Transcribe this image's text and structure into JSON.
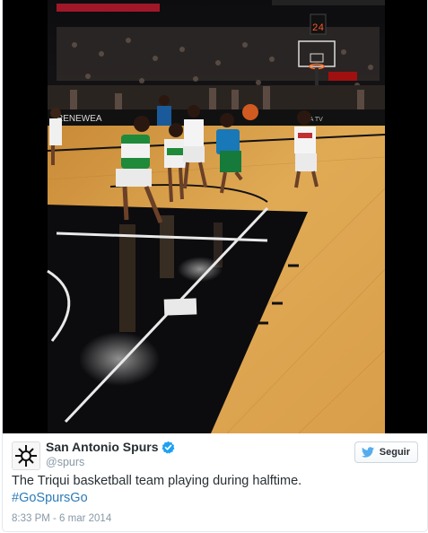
{
  "tweet": {
    "author": {
      "display_name": "San Antonio Spurs",
      "screen_name": "@spurs",
      "verified": true,
      "avatar_icon": "spurs-logo-icon"
    },
    "follow_button": {
      "label": "Seguir",
      "icon": "twitter-bird-icon"
    },
    "text": "The Triqui basketball team playing during halftime.",
    "hashtag": "#GoSpursGo",
    "timestamp": "8:33 PM - 6 mar 2014",
    "media": {
      "scoreboard": "24",
      "banner": "RENEWEA",
      "ad_label": "NBA TV"
    },
    "colors": {
      "link": "#2b7bb9",
      "verified": "#1da1f2",
      "secondary_text": "#8899a6",
      "court_wood": "#d9a24e",
      "paint": "#0c0c0e"
    }
  }
}
